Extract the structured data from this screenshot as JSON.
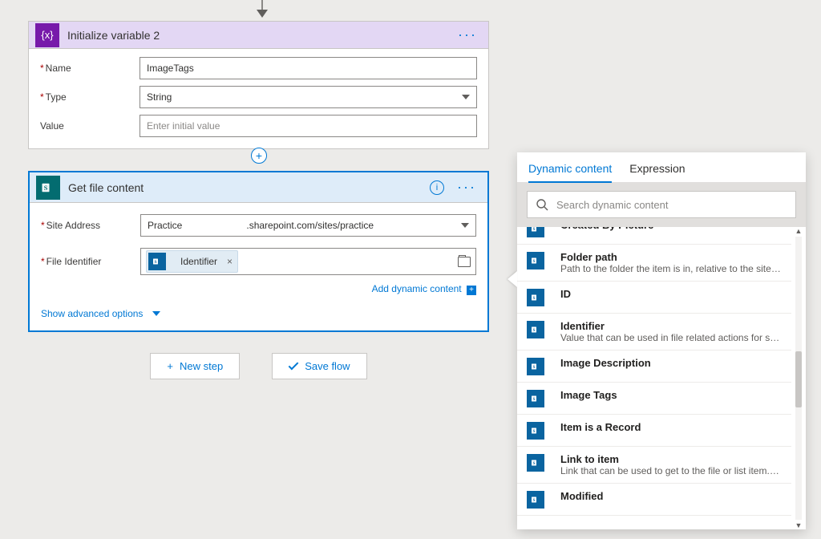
{
  "connector": {
    "plus": "+"
  },
  "card1": {
    "title": "Initialize variable 2",
    "menu_dots": "···",
    "fields": {
      "name_label": "Name",
      "name_value": "ImageTags",
      "type_label": "Type",
      "type_value": "String",
      "value_label": "Value",
      "value_placeholder": "Enter initial value"
    }
  },
  "card2": {
    "title": "Get file content",
    "info": "i",
    "menu_dots": "···",
    "fields": {
      "site_label": "Site Address",
      "site_value_left": "Practice ",
      "site_value_right": ".sharepoint.com/sites/practice",
      "fileid_label": "File Identifier",
      "token_label": "Identifier",
      "token_close": "×"
    },
    "add_dynamic": "Add dynamic content",
    "show_advanced": "Show advanced options"
  },
  "panel": {
    "tabs": {
      "dynamic": "Dynamic content",
      "expression": "Expression"
    },
    "search_placeholder": "Search dynamic content",
    "items": [
      {
        "name": "Created By Picture",
        "desc": ""
      },
      {
        "name": "Folder path",
        "desc": "Path to the folder the item is in, relative to the site addre…"
      },
      {
        "name": "ID",
        "desc": ""
      },
      {
        "name": "Identifier",
        "desc": "Value that can be used in file related actions for selecting…"
      },
      {
        "name": "Image Description",
        "desc": ""
      },
      {
        "name": "Image Tags",
        "desc": ""
      },
      {
        "name": "Item is a Record",
        "desc": ""
      },
      {
        "name": "Link to item",
        "desc": "Link that can be used to get to the file or list item. Only p…"
      },
      {
        "name": "Modified",
        "desc": ""
      }
    ]
  },
  "actions": {
    "new_step": "New step",
    "save_flow": "Save flow",
    "plus": "+"
  },
  "icons": {
    "variable_fx": "{x}",
    "sharepoint": "s"
  }
}
